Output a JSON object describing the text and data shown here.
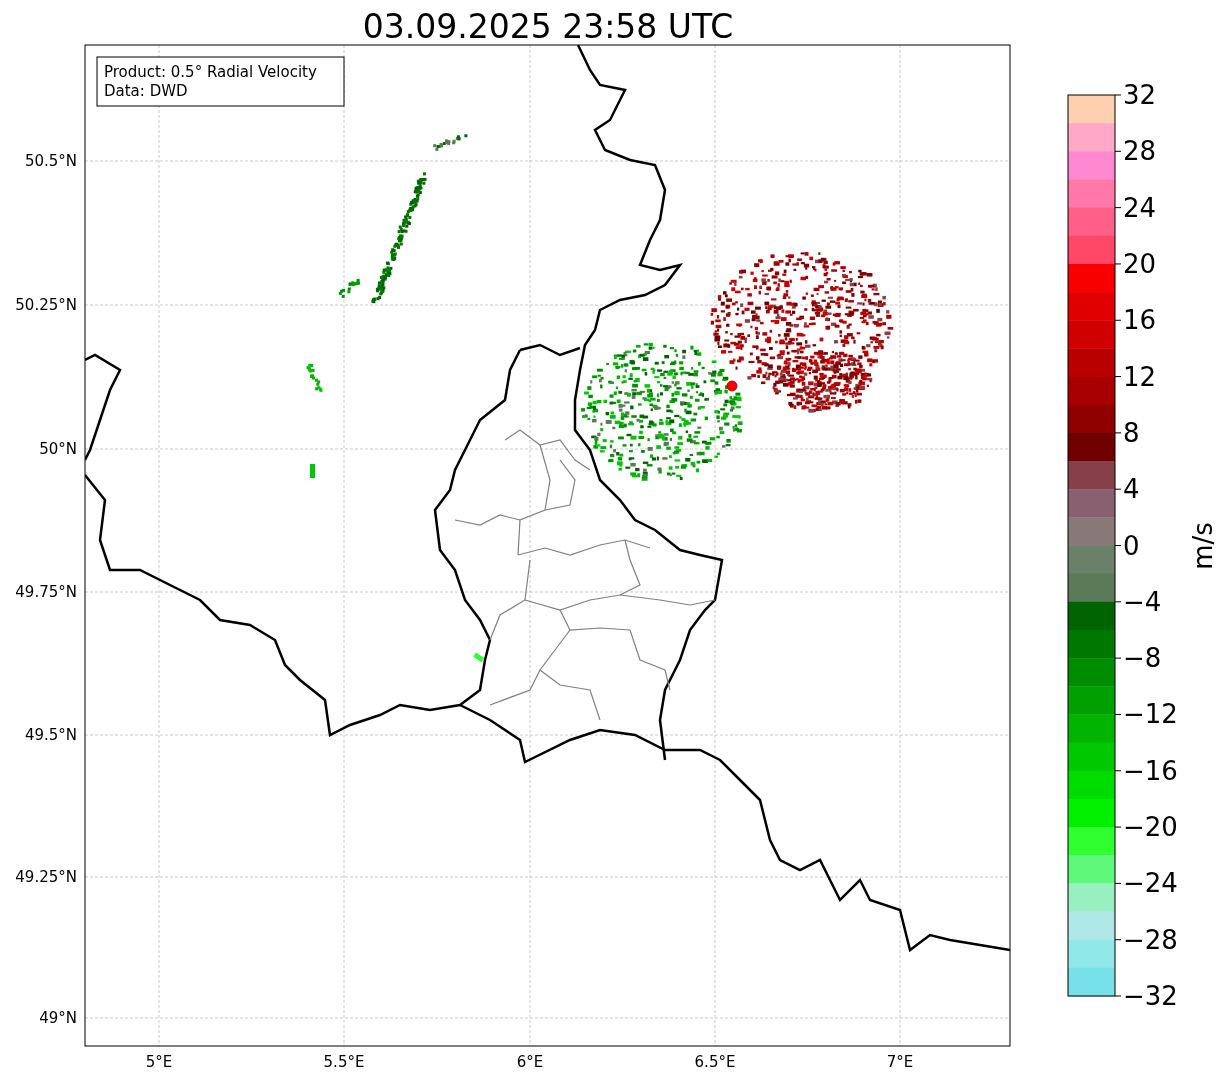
{
  "title": "03.09.2025 23:58 UTC",
  "map": {
    "info_box": [
      "Product: 0.5° Radial Velocity",
      "Data: DWD"
    ],
    "lat_labels": [
      "50.5°N",
      "50.25°N",
      "50°N",
      "49.75°N",
      "49.5°N",
      "49.25°N",
      "49°N"
    ],
    "lon_labels": [
      "5°E",
      "5.5°E",
      "6°E",
      "6.5°E",
      "7°E"
    ]
  },
  "colorbar": {
    "label": "m/s",
    "ticks": [
      "32",
      "28",
      "24",
      "20",
      "16",
      "12",
      "8",
      "4",
      "0",
      "−4",
      "−8",
      "−12",
      "−16",
      "−20",
      "−24",
      "−28",
      "−32"
    ],
    "bands": [
      {
        "color": "#ffd0b0"
      },
      {
        "color": "#ffa8c8"
      },
      {
        "color": "#ff88d0"
      },
      {
        "color": "#ff78a8"
      },
      {
        "color": "#ff6088"
      },
      {
        "color": "#ff4868"
      },
      {
        "color": "#f80000"
      },
      {
        "color": "#e00000"
      },
      {
        "color": "#d00000"
      },
      {
        "color": "#b80000"
      },
      {
        "color": "#a80000"
      },
      {
        "color": "#900000"
      },
      {
        "color": "#700000"
      },
      {
        "color": "#884048"
      },
      {
        "color": "#886070"
      },
      {
        "color": "#887878"
      },
      {
        "color": "#6a8068"
      },
      {
        "color": "#5a7a58"
      },
      {
        "color": "#006400"
      },
      {
        "color": "#007800"
      },
      {
        "color": "#008c00"
      },
      {
        "color": "#00a000"
      },
      {
        "color": "#00b400"
      },
      {
        "color": "#00c800"
      },
      {
        "color": "#00dc00"
      },
      {
        "color": "#00f000"
      },
      {
        "color": "#30ff30"
      },
      {
        "color": "#60f878"
      },
      {
        "color": "#98f0c0"
      },
      {
        "color": "#b0e8e8"
      },
      {
        "color": "#90e8e8"
      },
      {
        "color": "#78e0e8"
      }
    ]
  }
}
